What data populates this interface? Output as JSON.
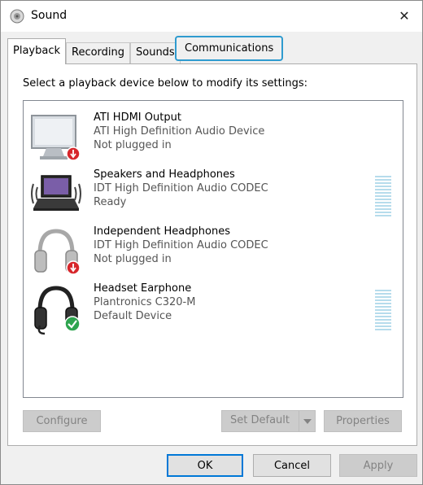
{
  "window": {
    "title": "Sound",
    "icon": "speaker-icon",
    "close_glyph": "✕"
  },
  "tabs": [
    {
      "label": "Playback",
      "active": true
    },
    {
      "label": "Recording",
      "active": false
    },
    {
      "label": "Sounds",
      "active": false
    },
    {
      "label": "Communications",
      "active": false,
      "focused": true
    }
  ],
  "instruction": "Select a playback device below to modify its settings:",
  "devices": [
    {
      "name": "ATI HDMI Output",
      "driver": "ATI High Definition Audio Device",
      "status": "Not plugged in",
      "icon": "monitor-icon",
      "badge": "unplugged-badge-icon"
    },
    {
      "name": "Speakers and Headphones",
      "driver": "IDT High Definition Audio CODEC",
      "status": "Ready",
      "icon": "laptop-speakers-icon",
      "level_meter": true
    },
    {
      "name": "Independent Headphones",
      "driver": "IDT High Definition Audio CODEC",
      "status": "Not plugged in",
      "icon": "headphones-icon",
      "badge": "unplugged-badge-icon"
    },
    {
      "name": "Headset Earphone",
      "driver": "Plantronics C320-M",
      "status": "Default Device",
      "icon": "headset-icon",
      "badge": "default-check-icon",
      "level_meter": true
    }
  ],
  "buttons": {
    "configure": "Configure",
    "set_default": "Set Default",
    "properties": "Properties",
    "ok": "OK",
    "cancel": "Cancel",
    "apply": "Apply"
  },
  "colors": {
    "focus_ring": "#2f9bcf",
    "default_button_border": "#0078d7",
    "level_meter": "#b6dcec",
    "unplugged_badge": "#d7262b",
    "default_check": "#2ea44f"
  }
}
